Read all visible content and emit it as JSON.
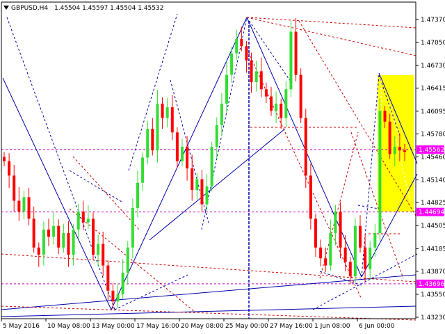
{
  "header": {
    "symbol": "GBPUSD,H4",
    "ohlc_values": "1.45504 1.45597 1.45504 1.45532",
    "arrow_icon": "triangle-down-icon"
  },
  "colors": {
    "background": "#ffffff",
    "up_candle": "#33dd33",
    "down_candle": "#ff0000",
    "trendline": "#0000aa",
    "level_line": "#cc00cc",
    "dotted_red": "#cc0000",
    "highlight_box": "#ffff00",
    "axis": "#000000"
  },
  "chart_data": {
    "type": "candlestick",
    "timeframe": "H4",
    "y_ticks": [
      "1.47370",
      "1.47050",
      "1.46730",
      "1.46415",
      "1.46095",
      "1.45780",
      "1.45460",
      "1.45140",
      "1.44825",
      "1.44505",
      "1.44185",
      "1.43870",
      "1.43550",
      "1.43230"
    ],
    "x_ticks": [
      "5 May 2016",
      "10 May 08:00",
      "13 May 00:00",
      "17 May 16:00",
      "20 May 08:00",
      "25 May 00:00",
      "27 May 16:00",
      "1 Jun 08:00",
      "6 Jun 00:00"
    ],
    "ylim": [
      1.4323,
      1.4752
    ],
    "levels": [
      {
        "label": "1.45562",
        "value": 1.45562,
        "color": "#ff00ff"
      },
      {
        "label": "1.44694",
        "value": 1.44694,
        "color": "#ff00ff"
      },
      {
        "label": "1.43696",
        "value": 1.43696,
        "color": "#ff00ff"
      }
    ],
    "close_series": [
      1.454,
      1.452,
      1.4485,
      1.447,
      1.449,
      1.446,
      1.442,
      1.441,
      1.4445,
      1.4435,
      1.445,
      1.442,
      1.444,
      1.441,
      1.4445,
      1.447,
      1.4455,
      1.446,
      1.441,
      1.4425,
      1.4395,
      1.436,
      1.4345,
      1.4355,
      1.4385,
      1.442,
      1.4475,
      1.451,
      1.4545,
      1.4585,
      1.4555,
      1.462,
      1.46,
      1.4615,
      1.458,
      1.454,
      1.456,
      1.453,
      1.45,
      1.4515,
      1.448,
      1.4505,
      1.456,
      1.459,
      1.462,
      1.466,
      1.469,
      1.471,
      1.47,
      1.468,
      1.465,
      1.4665,
      1.464,
      1.463,
      1.461,
      1.462,
      1.46,
      1.464,
      1.472,
      1.466,
      1.46,
      1.452,
      1.446,
      1.442,
      1.4405,
      1.4395,
      1.444,
      1.447,
      1.442,
      1.44,
      1.438,
      1.445,
      1.442,
      1.439,
      1.442,
      1.444,
      1.461,
      1.4595,
      1.455,
      1.456,
      1.4555,
      1.4553
    ]
  }
}
